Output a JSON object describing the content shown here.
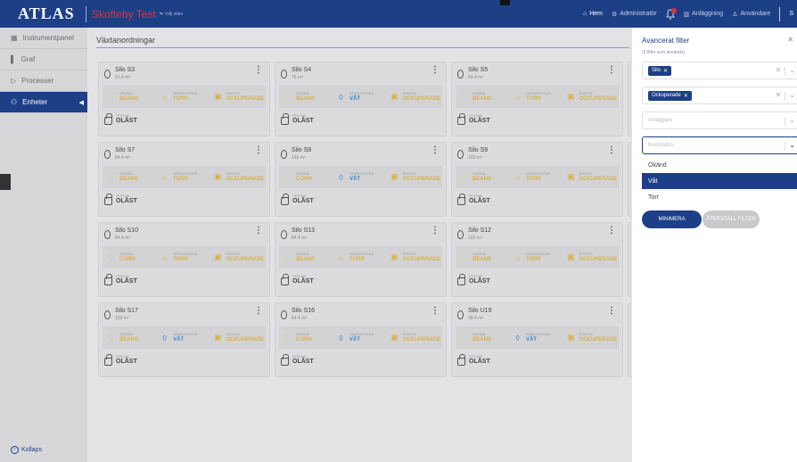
{
  "app": {
    "logo": "ATLAS",
    "site": "Skofteby Test",
    "site_sub": "Välj sites"
  },
  "nav": {
    "home": "Hem",
    "admin": "Administratör",
    "facility": "Anläggning",
    "users": "Användare",
    "edge": "S"
  },
  "sidebar": {
    "items": [
      {
        "label": "Instrumentpanel",
        "icon": "dashboard-icon"
      },
      {
        "label": "Graf",
        "icon": "chart-icon"
      },
      {
        "label": "Processer",
        "icon": "play-icon"
      },
      {
        "label": "Enheter",
        "icon": "device-icon",
        "active": true
      }
    ],
    "collapse": "Kollaps"
  },
  "main": {
    "title": "Växtanordningar"
  },
  "labels": {
    "crop": "GRÖDA",
    "crop_status": "GRÖDSTATUS",
    "status": "STATUS"
  },
  "silos": [
    {
      "name": "Silo S3",
      "volume": "51.4 m³",
      "crop": "BEANS",
      "crop_status": "TORR",
      "crop_status_icon": "sun-icon",
      "status": "OCKUPERADE",
      "lock": "OLÅST"
    },
    {
      "name": "Silo S4",
      "volume": "76 m³",
      "crop": "BEANS",
      "crop_status": "VÅT",
      "crop_status_icon": "drop-icon",
      "status": "OCKUPERADE",
      "lock": "OLÅST"
    },
    {
      "name": "Silo S5",
      "volume": "84.4 m³",
      "crop": "BEANS",
      "crop_status": "TORR",
      "crop_status_icon": "sun-icon",
      "status": "OCKUPERADE",
      "lock": "OLÅST"
    },
    {
      "name": "Silo S7",
      "volume": "84.4 m³",
      "crop": "BEANS",
      "crop_status": "TORR",
      "crop_status_icon": "sun-icon",
      "status": "OCKUPERADE",
      "lock": "OLÅST"
    },
    {
      "name": "Silo S8",
      "volume": "160 m³",
      "crop": "CORN",
      "crop_status": "VÅT",
      "crop_status_icon": "drop-icon",
      "status": "OCKUPERADE",
      "lock": "OLÅST"
    },
    {
      "name": "Silo S9",
      "volume": "103 m³",
      "crop": "BEANS",
      "crop_status": "TORR",
      "crop_status_icon": "sun-icon",
      "status": "OCKUPERADE",
      "lock": "OLÅST"
    },
    {
      "name": "Silo S10",
      "volume": "84.4 m³",
      "crop": "CORN",
      "crop_status": "TORR",
      "crop_status_icon": "sun-icon",
      "status": "OCKUPERADE",
      "lock": "OLÅST"
    },
    {
      "name": "Silo S13",
      "volume": "84.4 m³",
      "crop": "BEANS",
      "crop_status": "TORR",
      "crop_status_icon": "sun-icon",
      "status": "OCKUPERADE",
      "lock": "OLÅST"
    },
    {
      "name": "Silo S12",
      "volume": "103 m³",
      "crop": "BEANS",
      "crop_status": "TORR",
      "crop_status_icon": "sun-icon",
      "status": "OCKUPERADE",
      "lock": "OLÅST"
    },
    {
      "name": "Silo S17",
      "volume": "103 m³",
      "crop": "BEANS",
      "crop_status": "VÅT",
      "crop_status_icon": "drop-icon",
      "status": "OCKUPERADE",
      "lock": "OLÅST"
    },
    {
      "name": "Silo S16",
      "volume": "84.4 m³",
      "crop": "CORN",
      "crop_status": "VÅT",
      "crop_status_icon": "drop-icon",
      "status": "OCKUPERADE",
      "lock": "OLÅST"
    },
    {
      "name": "Silo U19",
      "volume": "58.4 m³",
      "crop": "BEANS",
      "crop_status": "VÅT",
      "crop_status_icon": "drop-icon",
      "status": "OCKUPERADE",
      "lock": "OLÅST"
    }
  ],
  "filter": {
    "title": "Avancerat filter",
    "subtitle": "(2 filter som används)",
    "chip1": "Silo",
    "chip2": "Ockuperade",
    "placeholder3": "Anläggare",
    "placeholder4": "Kornstatus",
    "options": [
      "Okänd",
      "Våt",
      "Torr"
    ],
    "selected_option": "Våt",
    "minimize": "MINIMERA",
    "reset": "ÅTERSTÄLL FILTER"
  },
  "colors": {
    "brand": "#1d3f86",
    "site": "#e0313a",
    "crop": "#d7b34a",
    "wet": "#3b84c6"
  }
}
